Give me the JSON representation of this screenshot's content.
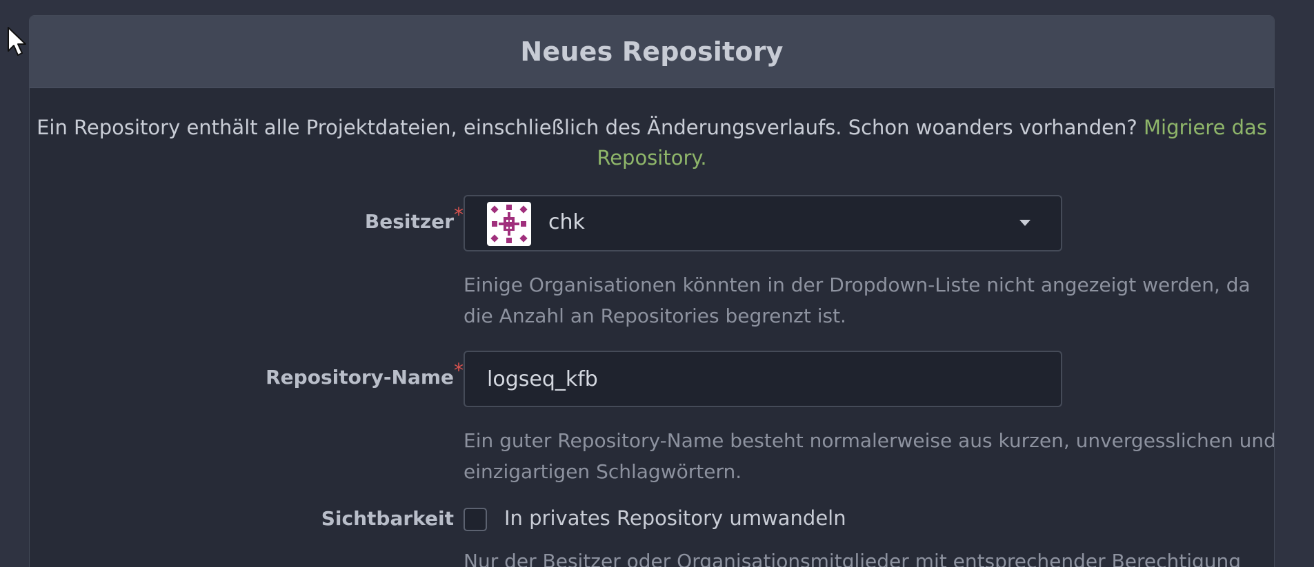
{
  "panel": {
    "title": "Neues Repository"
  },
  "intro": {
    "text": "Ein Repository enthält alle Projektdateien, einschließlich des Änderungsverlaufs. Schon woanders vorhanden?",
    "link_line1": "Migriere das",
    "link_line2": "Repository."
  },
  "owner": {
    "label": "Besitzer",
    "required_marker": "*",
    "value": "chk",
    "help": "Einige Organisationen könnten in der Dropdown-Liste nicht angezeigt werden, da die Anzahl an Repositories begrenzt ist."
  },
  "repo_name": {
    "label": "Repository-Name",
    "required_marker": "*",
    "value": "logseq_kfb",
    "help": "Ein guter Repository-Name besteht normalerweise aus kurzen, unvergesslichen und einzigartigen Schlagwörtern."
  },
  "visibility": {
    "label": "Sichtbarkeit",
    "checkbox_label": "In privates Repository umwandeln",
    "help_partial": "Nur der Besitzer oder Organisationsmitglieder mit entsprechender Berechtigung"
  },
  "colors": {
    "background": "#2f3341",
    "panel": "#272b37",
    "header": "#414756",
    "link": "#8fb66a",
    "required": "#d9534f",
    "avatar": "#a02f7c"
  },
  "icons": {
    "cursor": "mouse-pointer-icon",
    "avatar": "identicon-avatar",
    "dropdown": "caret-down-icon"
  }
}
